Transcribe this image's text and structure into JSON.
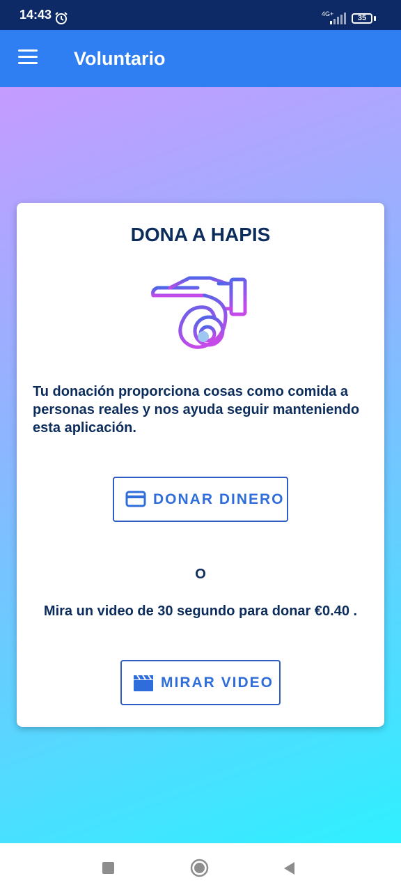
{
  "status_bar": {
    "time": "14:43",
    "network": "4G+",
    "battery": "35"
  },
  "app_bar": {
    "title": "Voluntario"
  },
  "card": {
    "title": "DONA A HAPIS",
    "description": "Tu donación proporciona cosas como comida a personas reales y nos ayuda seguir manteniendo esta aplicación.",
    "donate_button": "DONAR DINERO",
    "or_text": "O",
    "video_text": "Mira un video de 30 segundo para donar €0.40 .",
    "video_button": "MIRAR VIDEO"
  },
  "icons": {
    "menu": "hamburger-icon",
    "donate": "credit-card-icon",
    "video": "clapperboard-icon",
    "hero": "hand-coin-icon"
  },
  "colors": {
    "app_bar": "#2f7ff2",
    "status_bar": "#0d2a66",
    "title_text": "#0c2c5c",
    "button_text": "#2f6ddb",
    "gradient_top": "#c59bff",
    "gradient_bottom": "#2ff0ff"
  }
}
